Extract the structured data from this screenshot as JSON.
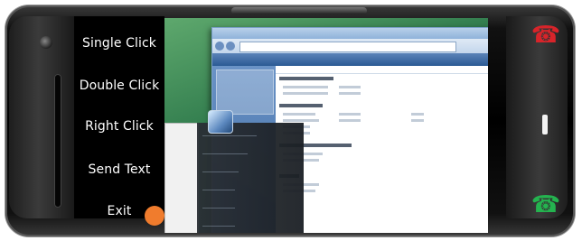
{
  "menu": {
    "items": [
      {
        "label": "Single Click"
      },
      {
        "label": "Double Click"
      },
      {
        "label": "Right Click"
      },
      {
        "label": "Send Text"
      },
      {
        "label": "Exit"
      }
    ]
  },
  "phone": {
    "end_key_icon": "end-call-icon",
    "menu_key_icon": "menu-key",
    "call_key_icon": "call-icon"
  },
  "colors": {
    "menu_text": "#ffffff",
    "end_key": "#d8242a",
    "call_key": "#24b34f",
    "touch_indicator": "#f07c2d"
  }
}
